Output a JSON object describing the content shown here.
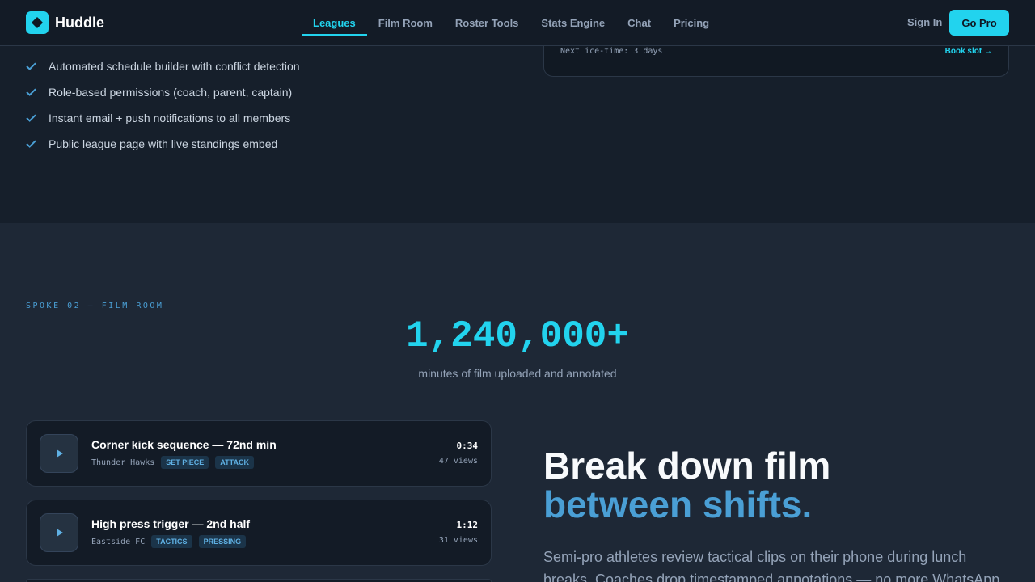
{
  "brand": {
    "name": "Huddle"
  },
  "nav": {
    "items": [
      {
        "label": "Leagues",
        "active": true
      },
      {
        "label": "Film Room"
      },
      {
        "label": "Roster Tools"
      },
      {
        "label": "Stats Engine"
      },
      {
        "label": "Chat"
      },
      {
        "label": "Pricing"
      }
    ],
    "sign_in": "Sign In",
    "cta": "Go Pro"
  },
  "leagues": {
    "features": [
      "Automated schedule builder with conflict detection",
      "Role-based permissions (coach, parent, captain)",
      "Instant email + push notifications to all members",
      "Public league page with live standings embed"
    ],
    "card": {
      "next_ice": "Next ice-time: 3 days",
      "link": "Book slot →"
    }
  },
  "film_room": {
    "eyebrow": "SPOKE 02 — FILM ROOM",
    "stat_value": "1,240,000+",
    "stat_caption": "minutes of film uploaded and annotated",
    "clips": [
      {
        "title": "Corner kick sequence — 72nd min",
        "team": "Thunder Hawks",
        "tags": [
          "SET PIECE",
          "ATTACK"
        ],
        "duration": "0:34",
        "views": "47 views"
      },
      {
        "title": "High press trigger — 2nd half",
        "team": "Eastside FC",
        "tags": [
          "TACTICS",
          "PRESSING"
        ],
        "duration": "1:12",
        "views": "31 views"
      }
    ],
    "headline_line1": "Break down film",
    "headline_line2": "between shifts.",
    "paragraph": "Semi-pro athletes review tactical clips on their phone during lunch breaks. Coaches drop timestamped annotations — no more WhatsApp"
  },
  "colors": {
    "accent": "#22d3ee",
    "secondary": "#4a9fd5",
    "background": "#1e2836",
    "panel": "#131b26"
  }
}
